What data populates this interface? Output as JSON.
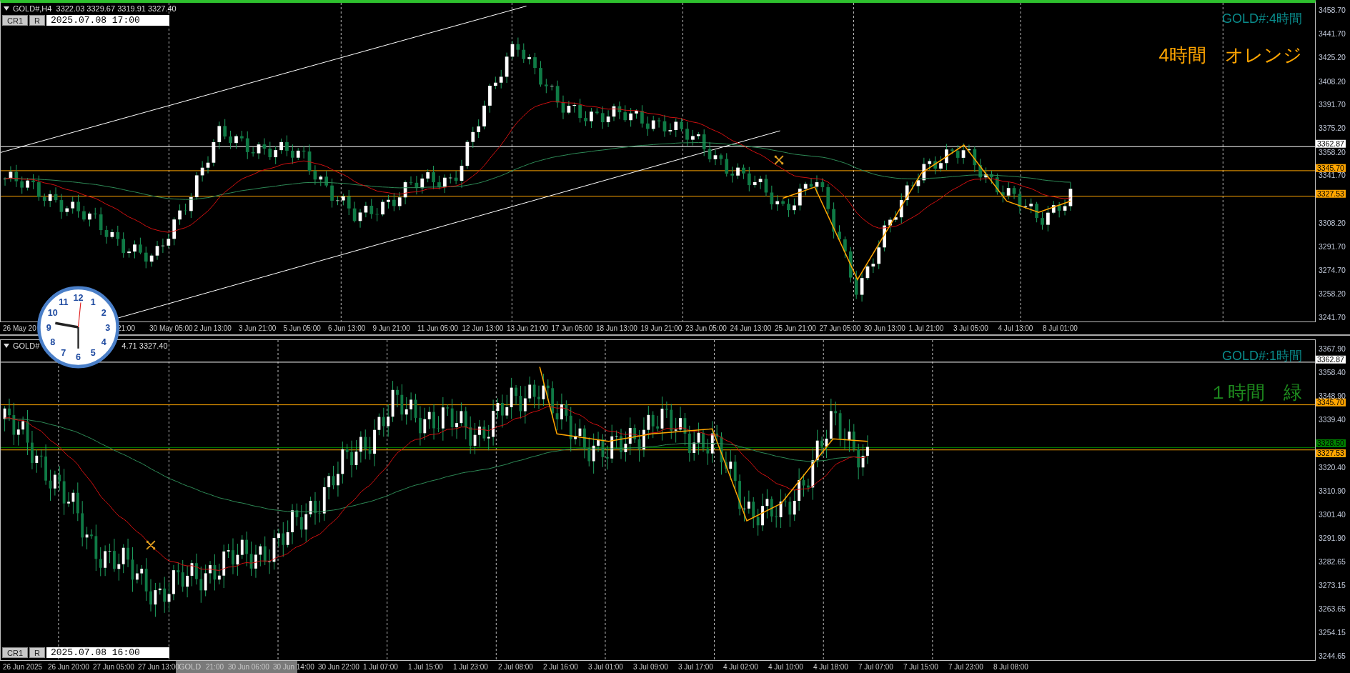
{
  "panels": [
    {
      "header": [
        "GOLD#,H4  3322.03 3329.67 3319.91 3327.40"
      ],
      "controls": [
        "CR1",
        "R"
      ],
      "datetime": "2025.07.08 17:00",
      "symbol_label": "GOLD#:4時間",
      "note": "4時間　オレンジ",
      "price_ticks": [
        "3458.70",
        "3441.70",
        "3425.20",
        "3408.20",
        "3391.70",
        "3375.20",
        "3358.20",
        "3341.70",
        "3308.20",
        "3291.70",
        "3274.70",
        "3258.20",
        "3241.70"
      ],
      "hlines": [
        {
          "price": "3362.87",
          "color": "#ffffff"
        },
        {
          "price": "3345.70",
          "color": "#ffa500"
        },
        {
          "price": "3327.53",
          "color": "#ffa500"
        }
      ],
      "time_labels": [
        "26 May 20",
        "21:00",
        "30 May 05:00",
        "2 Jun 13:00",
        "3 Jun 21:00",
        "5 Jun 05:00",
        "6 Jun 13:00",
        "9 Jun 21:00",
        "11 Jun 05:00",
        "12 Jun 13:00",
        "13 Jun 21:00",
        "17 Jun 05:00",
        "18 Jun 13:00",
        "19 Jun 21:00",
        "23 Jun 05:00",
        "24 Jun 13:00",
        "25 Jun 21:00",
        "27 Jun 05:00",
        "30 Jun 13:00",
        "1 Jul 21:00",
        "3 Jul 05:00",
        "4 Jul 13:00",
        "8 Jul 01:00"
      ]
    },
    {
      "header": [
        "GOLD#",
        "4.71 3327.40"
      ],
      "controls": [
        "CR1",
        "R"
      ],
      "datetime": "2025.07.08 16:00",
      "symbol_label": "GOLD#:1時間",
      "note": "１時間　緑",
      "price_ticks": [
        "3367.90",
        "3358.40",
        "3348.90",
        "3339.40",
        "3320.40",
        "3310.90",
        "3301.40",
        "3291.90",
        "3282.65",
        "3273.15",
        "3263.65",
        "3254.15",
        "3244.65"
      ],
      "hlines": [
        {
          "price": "3362.87",
          "color": "#ffffff"
        },
        {
          "price": "3345.70",
          "color": "#ffa500"
        },
        {
          "price": "3328.50",
          "color": "#008000"
        },
        {
          "price": "3327.53",
          "color": "#ffa500"
        }
      ],
      "time_labels": [
        "26 Jun 2025",
        "26 Jun 20:00",
        "27 Jun 05:00",
        "27 Jun 13:00",
        "21:00",
        "30 Jun 06:00",
        "30 Jun 14:00",
        "30 Jun 22:00",
        "1 Jul 07:00",
        "1 Jul 15:00",
        "1 Jul 23:00",
        "2 Jul 08:00",
        "2 Jul 16:00",
        "3 Jul 01:00",
        "3 Jul 09:00",
        "3 Jul 17:00",
        "4 Jul 02:00",
        "4 Jul 10:00",
        "4 Jul 18:00",
        "7 Jul 07:00",
        "7 Jul 15:00",
        "7 Jul 23:00",
        "8 Jul 08:00"
      ],
      "time_highlight": "GOLD"
    }
  ],
  "clock": {
    "numbers": [
      "12",
      "11",
      "1",
      "10",
      "2",
      "9",
      "3",
      "8",
      "4",
      "7",
      "5",
      "6"
    ]
  }
}
